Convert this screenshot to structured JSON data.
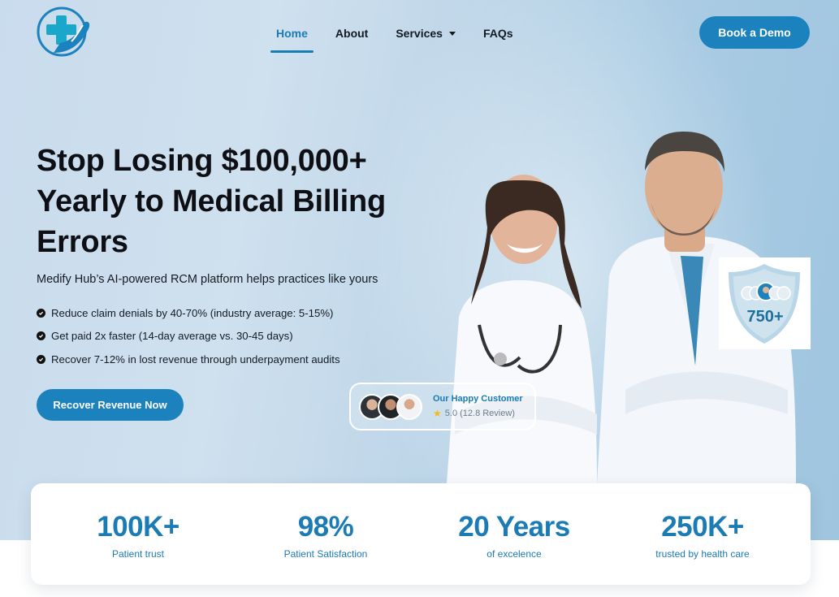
{
  "header": {
    "nav": [
      {
        "label": "Home",
        "active": true
      },
      {
        "label": "About"
      },
      {
        "label": "Services",
        "has_dropdown": true
      },
      {
        "label": "FAQs"
      }
    ],
    "cta_label": "Book a Demo"
  },
  "hero": {
    "headline": "Stop Losing $100,000+ Yearly to Medical Billing Errors",
    "subhead": "Medify Hub’s AI-powered RCM platform helps practices like yours",
    "bullets": [
      "Reduce claim denials by 40-70% (industry average: 5-15%)",
      "Get paid 2x faster (14-day average vs. 30-45 days)",
      "Recover 7-12% in lost revenue through underpayment audits"
    ],
    "cta_label": "Recover Revenue Now"
  },
  "happy_customer": {
    "title": "Our Happy Customer",
    "rating": "5.0 (12.8 Review)"
  },
  "badge": {
    "value": "750+"
  },
  "stats": [
    {
      "value": "100K+",
      "label": "Patient trust"
    },
    {
      "value": "98%",
      "label": "Patient Satisfaction"
    },
    {
      "value": "20 Years",
      "label": "of excelence"
    },
    {
      "value": "250K+",
      "label": "trusted by health care"
    }
  ],
  "colors": {
    "brand": "#1c82bd",
    "text": "#0d0f14",
    "hero_bg": "#c9dced"
  }
}
